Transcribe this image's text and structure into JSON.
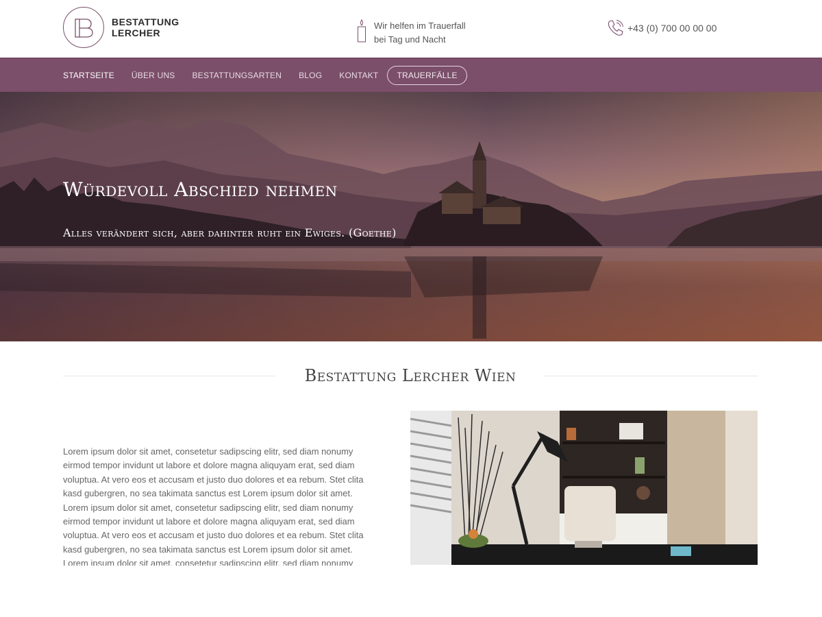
{
  "header": {
    "logo_line1": "BESTATTUNG",
    "logo_line2": "LERCHER",
    "help_line1": "Wir helfen im Trauerfall",
    "help_line2": "bei Tag und Nacht",
    "phone": "+43 (0) 700 00 00 00"
  },
  "nav": {
    "items": [
      {
        "label": "STARTSEITE",
        "active": true
      },
      {
        "label": "ÜBER UNS"
      },
      {
        "label": "BESTATTUNGSARTEN"
      },
      {
        "label": "BLOG"
      },
      {
        "label": "KONTAKT"
      }
    ],
    "button": "TRAUERFÄLLE"
  },
  "hero": {
    "title": "Würdevoll Abschied nehmen",
    "subtitle": "Alles verändert sich, aber dahinter ruht ein Ewiges. (Goethe)"
  },
  "section": {
    "title": "Bestattung Lercher Wien",
    "text": "Lorem ipsum dolor sit amet, consetetur sadipscing elitr, sed diam nonumy eirmod tempor invidunt ut labore et dolore magna aliquyam erat, sed diam voluptua. At vero eos et accusam et justo duo dolores et ea rebum. Stet clita kasd gubergren, no sea takimata sanctus est Lorem ipsum dolor sit amet. Lorem ipsum dolor sit amet, consetetur sadipscing elitr, sed diam nonumy eirmod tempor invidunt ut labore et dolore magna aliquyam erat, sed diam voluptua. At vero eos et accusam et justo duo dolores et ea rebum. Stet clita kasd gubergren, no sea takimata sanctus est Lorem ipsum dolor sit amet. Lorem ipsum dolor sit amet, consetetur sadipscing elitr, sed diam nonumy"
  },
  "colors": {
    "brand": "#7b4e6a",
    "nav_text": "#e8dbe3"
  },
  "icons": {
    "logo": "bl-monogram-icon",
    "help": "candle-icon",
    "phone": "phone-icon"
  }
}
